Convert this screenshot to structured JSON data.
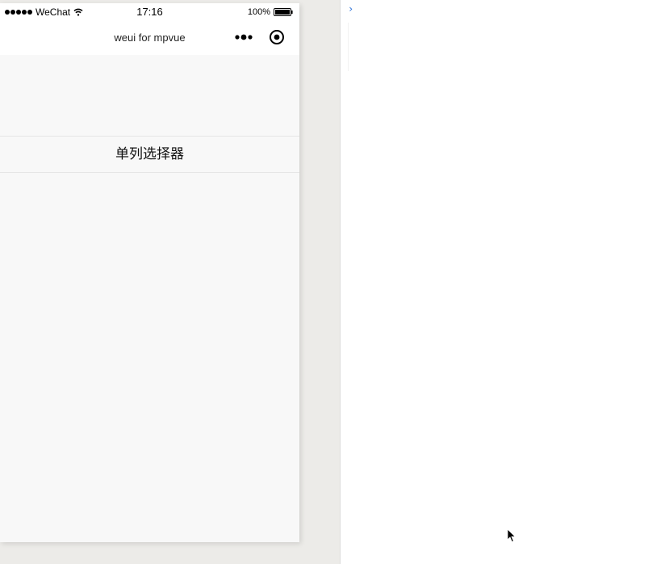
{
  "status_bar": {
    "carrier": "WeChat",
    "time": "17:16",
    "battery": "100%"
  },
  "nav_bar": {
    "title": "weui for mpvue"
  },
  "content": {
    "button_label": "单列选择器"
  },
  "console": {
    "prompt": "›"
  },
  "colors": {
    "page_background": "#f8f8f8",
    "nav_background": "#ffffff",
    "outer_background": "#ecebe8",
    "console_prompt": "#2b70d7"
  },
  "icons": {
    "signal": "signal-dots-icon",
    "wifi": "wifi-icon",
    "battery": "battery-icon",
    "more": "more-dots-icon",
    "close": "target-circle-icon",
    "cursor": "mouse-pointer-icon"
  }
}
